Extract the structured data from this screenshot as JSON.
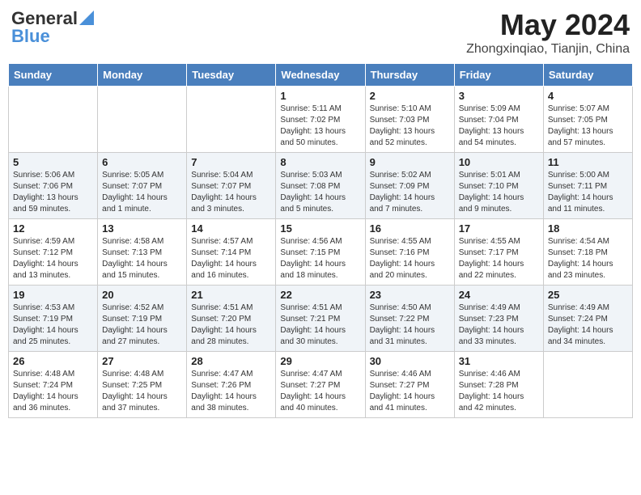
{
  "header": {
    "logo_line1": "General",
    "logo_line2": "Blue",
    "month": "May 2024",
    "location": "Zhongxinqiao, Tianjin, China"
  },
  "weekdays": [
    "Sunday",
    "Monday",
    "Tuesday",
    "Wednesday",
    "Thursday",
    "Friday",
    "Saturday"
  ],
  "weeks": [
    [
      {
        "day": "",
        "sunrise": "",
        "sunset": "",
        "daylight": ""
      },
      {
        "day": "",
        "sunrise": "",
        "sunset": "",
        "daylight": ""
      },
      {
        "day": "",
        "sunrise": "",
        "sunset": "",
        "daylight": ""
      },
      {
        "day": "1",
        "sunrise": "Sunrise: 5:11 AM",
        "sunset": "Sunset: 7:02 PM",
        "daylight": "Daylight: 13 hours and 50 minutes."
      },
      {
        "day": "2",
        "sunrise": "Sunrise: 5:10 AM",
        "sunset": "Sunset: 7:03 PM",
        "daylight": "Daylight: 13 hours and 52 minutes."
      },
      {
        "day": "3",
        "sunrise": "Sunrise: 5:09 AM",
        "sunset": "Sunset: 7:04 PM",
        "daylight": "Daylight: 13 hours and 54 minutes."
      },
      {
        "day": "4",
        "sunrise": "Sunrise: 5:07 AM",
        "sunset": "Sunset: 7:05 PM",
        "daylight": "Daylight: 13 hours and 57 minutes."
      }
    ],
    [
      {
        "day": "5",
        "sunrise": "Sunrise: 5:06 AM",
        "sunset": "Sunset: 7:06 PM",
        "daylight": "Daylight: 13 hours and 59 minutes."
      },
      {
        "day": "6",
        "sunrise": "Sunrise: 5:05 AM",
        "sunset": "Sunset: 7:07 PM",
        "daylight": "Daylight: 14 hours and 1 minute."
      },
      {
        "day": "7",
        "sunrise": "Sunrise: 5:04 AM",
        "sunset": "Sunset: 7:07 PM",
        "daylight": "Daylight: 14 hours and 3 minutes."
      },
      {
        "day": "8",
        "sunrise": "Sunrise: 5:03 AM",
        "sunset": "Sunset: 7:08 PM",
        "daylight": "Daylight: 14 hours and 5 minutes."
      },
      {
        "day": "9",
        "sunrise": "Sunrise: 5:02 AM",
        "sunset": "Sunset: 7:09 PM",
        "daylight": "Daylight: 14 hours and 7 minutes."
      },
      {
        "day": "10",
        "sunrise": "Sunrise: 5:01 AM",
        "sunset": "Sunset: 7:10 PM",
        "daylight": "Daylight: 14 hours and 9 minutes."
      },
      {
        "day": "11",
        "sunrise": "Sunrise: 5:00 AM",
        "sunset": "Sunset: 7:11 PM",
        "daylight": "Daylight: 14 hours and 11 minutes."
      }
    ],
    [
      {
        "day": "12",
        "sunrise": "Sunrise: 4:59 AM",
        "sunset": "Sunset: 7:12 PM",
        "daylight": "Daylight: 14 hours and 13 minutes."
      },
      {
        "day": "13",
        "sunrise": "Sunrise: 4:58 AM",
        "sunset": "Sunset: 7:13 PM",
        "daylight": "Daylight: 14 hours and 15 minutes."
      },
      {
        "day": "14",
        "sunrise": "Sunrise: 4:57 AM",
        "sunset": "Sunset: 7:14 PM",
        "daylight": "Daylight: 14 hours and 16 minutes."
      },
      {
        "day": "15",
        "sunrise": "Sunrise: 4:56 AM",
        "sunset": "Sunset: 7:15 PM",
        "daylight": "Daylight: 14 hours and 18 minutes."
      },
      {
        "day": "16",
        "sunrise": "Sunrise: 4:55 AM",
        "sunset": "Sunset: 7:16 PM",
        "daylight": "Daylight: 14 hours and 20 minutes."
      },
      {
        "day": "17",
        "sunrise": "Sunrise: 4:55 AM",
        "sunset": "Sunset: 7:17 PM",
        "daylight": "Daylight: 14 hours and 22 minutes."
      },
      {
        "day": "18",
        "sunrise": "Sunrise: 4:54 AM",
        "sunset": "Sunset: 7:18 PM",
        "daylight": "Daylight: 14 hours and 23 minutes."
      }
    ],
    [
      {
        "day": "19",
        "sunrise": "Sunrise: 4:53 AM",
        "sunset": "Sunset: 7:19 PM",
        "daylight": "Daylight: 14 hours and 25 minutes."
      },
      {
        "day": "20",
        "sunrise": "Sunrise: 4:52 AM",
        "sunset": "Sunset: 7:19 PM",
        "daylight": "Daylight: 14 hours and 27 minutes."
      },
      {
        "day": "21",
        "sunrise": "Sunrise: 4:51 AM",
        "sunset": "Sunset: 7:20 PM",
        "daylight": "Daylight: 14 hours and 28 minutes."
      },
      {
        "day": "22",
        "sunrise": "Sunrise: 4:51 AM",
        "sunset": "Sunset: 7:21 PM",
        "daylight": "Daylight: 14 hours and 30 minutes."
      },
      {
        "day": "23",
        "sunrise": "Sunrise: 4:50 AM",
        "sunset": "Sunset: 7:22 PM",
        "daylight": "Daylight: 14 hours and 31 minutes."
      },
      {
        "day": "24",
        "sunrise": "Sunrise: 4:49 AM",
        "sunset": "Sunset: 7:23 PM",
        "daylight": "Daylight: 14 hours and 33 minutes."
      },
      {
        "day": "25",
        "sunrise": "Sunrise: 4:49 AM",
        "sunset": "Sunset: 7:24 PM",
        "daylight": "Daylight: 14 hours and 34 minutes."
      }
    ],
    [
      {
        "day": "26",
        "sunrise": "Sunrise: 4:48 AM",
        "sunset": "Sunset: 7:24 PM",
        "daylight": "Daylight: 14 hours and 36 minutes."
      },
      {
        "day": "27",
        "sunrise": "Sunrise: 4:48 AM",
        "sunset": "Sunset: 7:25 PM",
        "daylight": "Daylight: 14 hours and 37 minutes."
      },
      {
        "day": "28",
        "sunrise": "Sunrise: 4:47 AM",
        "sunset": "Sunset: 7:26 PM",
        "daylight": "Daylight: 14 hours and 38 minutes."
      },
      {
        "day": "29",
        "sunrise": "Sunrise: 4:47 AM",
        "sunset": "Sunset: 7:27 PM",
        "daylight": "Daylight: 14 hours and 40 minutes."
      },
      {
        "day": "30",
        "sunrise": "Sunrise: 4:46 AM",
        "sunset": "Sunset: 7:27 PM",
        "daylight": "Daylight: 14 hours and 41 minutes."
      },
      {
        "day": "31",
        "sunrise": "Sunrise: 4:46 AM",
        "sunset": "Sunset: 7:28 PM",
        "daylight": "Daylight: 14 hours and 42 minutes."
      },
      {
        "day": "",
        "sunrise": "",
        "sunset": "",
        "daylight": ""
      }
    ]
  ]
}
